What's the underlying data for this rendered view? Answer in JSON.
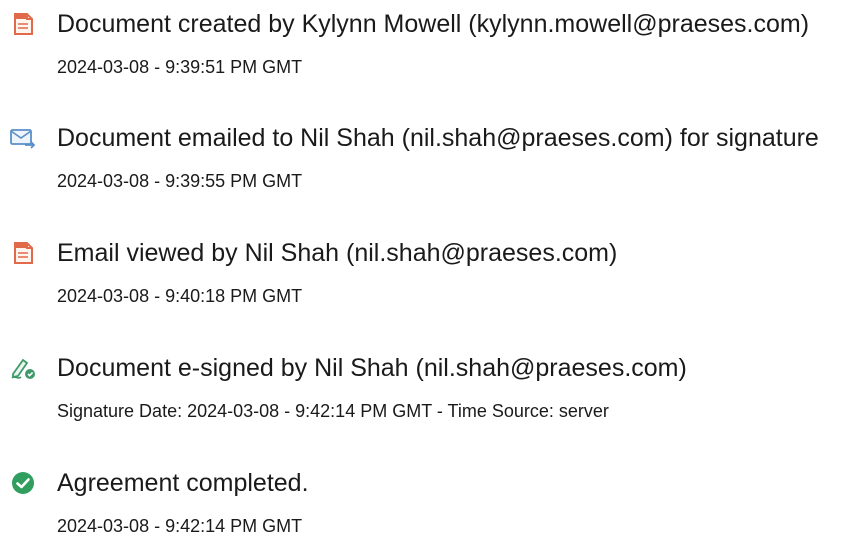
{
  "events": [
    {
      "icon": "document-created-icon",
      "title": "Document created by Kylynn Mowell (kylynn.mowell@praeses.com)",
      "subtitle": "2024-03-08 - 9:39:51 PM GMT"
    },
    {
      "icon": "email-sent-icon",
      "title": "Document emailed to Nil Shah (nil.shah@praeses.com) for signature",
      "subtitle": "2024-03-08 - 9:39:55 PM GMT"
    },
    {
      "icon": "email-viewed-icon",
      "title": "Email viewed by Nil Shah (nil.shah@praeses.com)",
      "subtitle": "2024-03-08 - 9:40:18 PM GMT"
    },
    {
      "icon": "esign-pen-icon",
      "title": "Document e-signed by Nil Shah (nil.shah@praeses.com)",
      "subtitle": "Signature Date: 2024-03-08 - 9:42:14 PM GMT - Time Source: server"
    },
    {
      "icon": "checkmark-circle-icon",
      "title": "Agreement completed.",
      "subtitle": "2024-03-08 - 9:42:14 PM GMT"
    }
  ],
  "colors": {
    "document_icon": "#e06a4a",
    "email_icon": "#5b8fc9",
    "pen_icon": "#3f9a6a",
    "check_icon": "#2f9e5e",
    "text": "#1a1a1a"
  }
}
